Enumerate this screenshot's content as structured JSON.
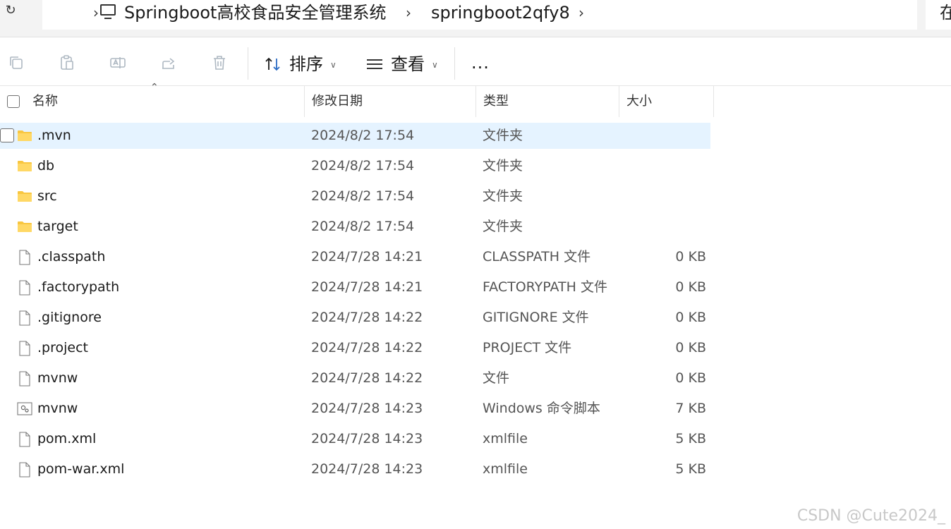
{
  "address_bar": {
    "path": [
      "Springboot高校食品安全管理系统",
      "springboot2qfy8"
    ],
    "search_fragment": "在"
  },
  "toolbar": {
    "sort_label": "排序",
    "view_label": "查看",
    "more_label": "..."
  },
  "columns": {
    "name": "名称",
    "modified": "修改日期",
    "type": "类型",
    "size": "大小"
  },
  "files": [
    {
      "name": ".mvn",
      "modified": "2024/8/2 17:54",
      "type": "文件夹",
      "size": "",
      "icon": "folder-icon",
      "selected": true
    },
    {
      "name": "db",
      "modified": "2024/8/2 17:54",
      "type": "文件夹",
      "size": "",
      "icon": "folder-icon"
    },
    {
      "name": "src",
      "modified": "2024/8/2 17:54",
      "type": "文件夹",
      "size": "",
      "icon": "folder-icon"
    },
    {
      "name": "target",
      "modified": "2024/8/2 17:54",
      "type": "文件夹",
      "size": "",
      "icon": "folder-icon"
    },
    {
      "name": ".classpath",
      "modified": "2024/7/28 14:21",
      "type": "CLASSPATH 文件",
      "size": "0 KB",
      "icon": "file-icon"
    },
    {
      "name": ".factorypath",
      "modified": "2024/7/28 14:21",
      "type": "FACTORYPATH 文件",
      "size": "0 KB",
      "icon": "file-icon"
    },
    {
      "name": ".gitignore",
      "modified": "2024/7/28 14:22",
      "type": "GITIGNORE 文件",
      "size": "0 KB",
      "icon": "file-icon"
    },
    {
      "name": ".project",
      "modified": "2024/7/28 14:22",
      "type": "PROJECT 文件",
      "size": "0 KB",
      "icon": "file-icon"
    },
    {
      "name": "mvnw",
      "modified": "2024/7/28 14:22",
      "type": "文件",
      "size": "0 KB",
      "icon": "file-icon"
    },
    {
      "name": "mvnw",
      "modified": "2024/7/28 14:23",
      "type": "Windows 命令脚本",
      "size": "7 KB",
      "icon": "script-icon"
    },
    {
      "name": "pom.xml",
      "modified": "2024/7/28 14:23",
      "type": "xmlfile",
      "size": "5 KB",
      "icon": "file-icon"
    },
    {
      "name": "pom-war.xml",
      "modified": "2024/7/28 14:23",
      "type": "xmlfile",
      "size": "5 KB",
      "icon": "file-icon"
    }
  ],
  "watermark": "CSDN @Cute2024_",
  "colors": {
    "selected_row": "#e5f3ff",
    "folder": "#f8c640",
    "toolbar_icon_disabled": "#aeb8c2"
  }
}
